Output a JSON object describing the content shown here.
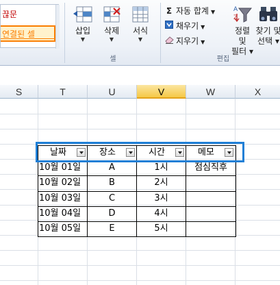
{
  "ribbon": {
    "styles": {
      "item1": "끊문",
      "item2": "연결된 셀"
    },
    "cells_group": {
      "label": "셀",
      "insert": "삽입",
      "delete": "삭제",
      "format": "서식"
    },
    "editing_group": {
      "label": "편집",
      "autosum": "자동 합계",
      "fill": "채우기",
      "clear": "지우기",
      "sort_filter": [
        "정렬 및",
        "필터"
      ],
      "find_select": [
        "찾기 및",
        "선택"
      ]
    }
  },
  "sheet": {
    "columns": [
      "S",
      "T",
      "U",
      "V",
      "W",
      "X"
    ],
    "selected_column": "V",
    "table_headers": [
      "날짜",
      "장소",
      "시간",
      "메모"
    ],
    "rows": [
      [
        "10월 01일",
        "A",
        "1시",
        "점심직후"
      ],
      [
        "10월 02일",
        "B",
        "2시",
        ""
      ],
      [
        "10월 03일",
        "C",
        "3시",
        ""
      ],
      [
        "10월 04일",
        "D",
        "4시",
        ""
      ],
      [
        "10월 05일",
        "E",
        "5시",
        ""
      ]
    ]
  },
  "colors": {
    "highlight": "#1f7fd6",
    "selected_header": "#f5c847",
    "style_red": "#c00000",
    "style_orange": "#fa7d00"
  }
}
